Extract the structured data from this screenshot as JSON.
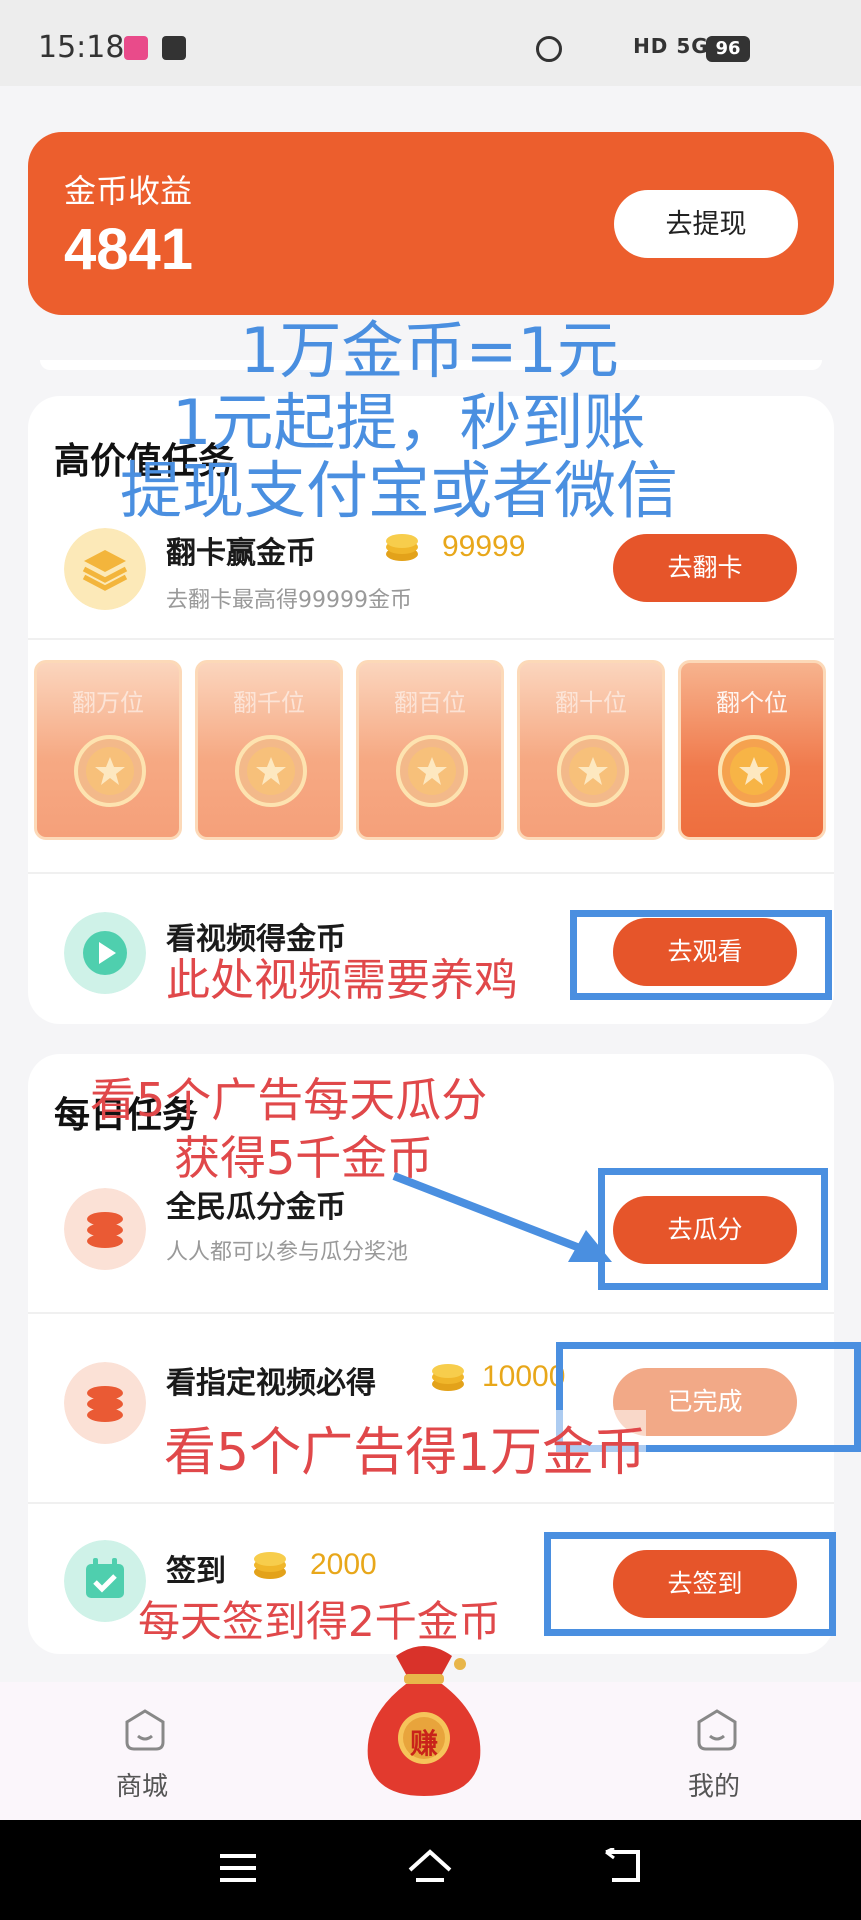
{
  "status_bar": {
    "time": "15:18",
    "right_text": "HD 5G 4G",
    "battery": "96"
  },
  "coin_header": {
    "label": "金币收益",
    "value": "4841",
    "withdraw_button": "去提现"
  },
  "high_value_section": {
    "title": "高价值任务",
    "flip_task": {
      "title": "翻卡赢金币",
      "amount": "99999",
      "subtitle": "去翻卡最高得99999金币",
      "button": "去翻卡"
    },
    "flip_cards": [
      {
        "label": "翻万位"
      },
      {
        "label": "翻千位"
      },
      {
        "label": "翻百位"
      },
      {
        "label": "翻十位"
      },
      {
        "label": "翻个位"
      }
    ],
    "video_task": {
      "title": "看视频得金币",
      "button": "去观看"
    }
  },
  "daily_section": {
    "title": "每日任务",
    "share_task": {
      "title": "全民瓜分金币",
      "subtitle": "人人都可以参与瓜分奖池",
      "button": "去瓜分"
    },
    "designated_video_task": {
      "title": "看指定视频必得",
      "amount": "10000",
      "button": "已完成"
    },
    "signin_task": {
      "title": "签到",
      "amount": "2000",
      "button": "去签到"
    }
  },
  "bottom_nav": {
    "mall": "商城",
    "earn": "赚",
    "mine": "我的"
  },
  "annotations": {
    "line1": "1万金币=1元",
    "line2": "1元起提，秒到账",
    "line3": "提现支付宝或者微信",
    "video_note": "此处视频需要养鸡",
    "share_note_1": "看5个广告每天瓜分",
    "share_note_2": "获得5千金币",
    "designated_note": "看5个广告得1万金币",
    "signin_note": "每天签到得2千金币"
  },
  "colors": {
    "brand_orange": "#e6552a",
    "header_orange": "#ec5e2d",
    "coin_gold": "#e8a71a",
    "annotation_blue": "#4a8fe0",
    "annotation_red": "#e0484a"
  }
}
